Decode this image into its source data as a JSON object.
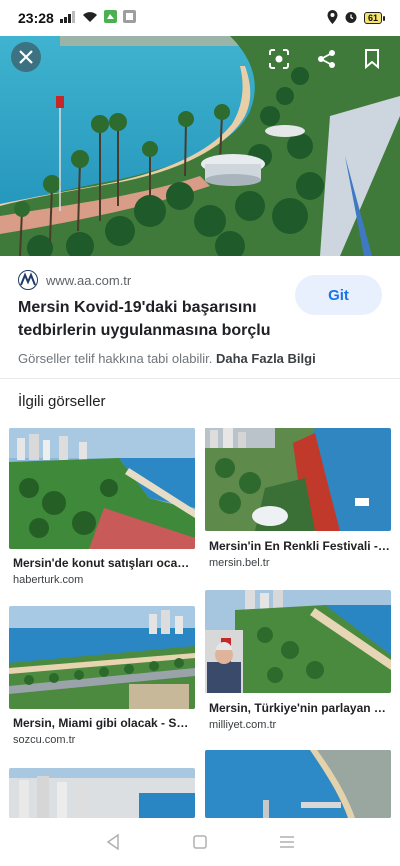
{
  "status_bar": {
    "time": "23:28",
    "battery": "61"
  },
  "hero": {
    "accent": "#1a73e8"
  },
  "result": {
    "source_url": "www.aa.com.tr",
    "title": "Mersin Kovid-19'daki başarısını tedbirlerin uygulanmasına borçlu",
    "visit_label": "Git",
    "copyright_text": "Görseller telif hakkına tabi olabilir.",
    "learn_more": "Daha Fazla Bilgi"
  },
  "related": {
    "heading": "İlgili görseller",
    "items": [
      {
        "title": "Mersin'de konut satışları oca…",
        "source": "haberturk.com"
      },
      {
        "title": "Mersin'in En Renkli Festivali - …",
        "source": "mersin.bel.tr"
      },
      {
        "title": "Mersin, Miami gibi olacak - S…",
        "source": "sozcu.com.tr"
      },
      {
        "title": "Mersin, Türkiye'nin parlayan y…",
        "source": "milliyet.com.tr"
      }
    ]
  },
  "nav": {
    "back": "back-icon",
    "home": "home-icon",
    "menu": "menu-icon"
  }
}
